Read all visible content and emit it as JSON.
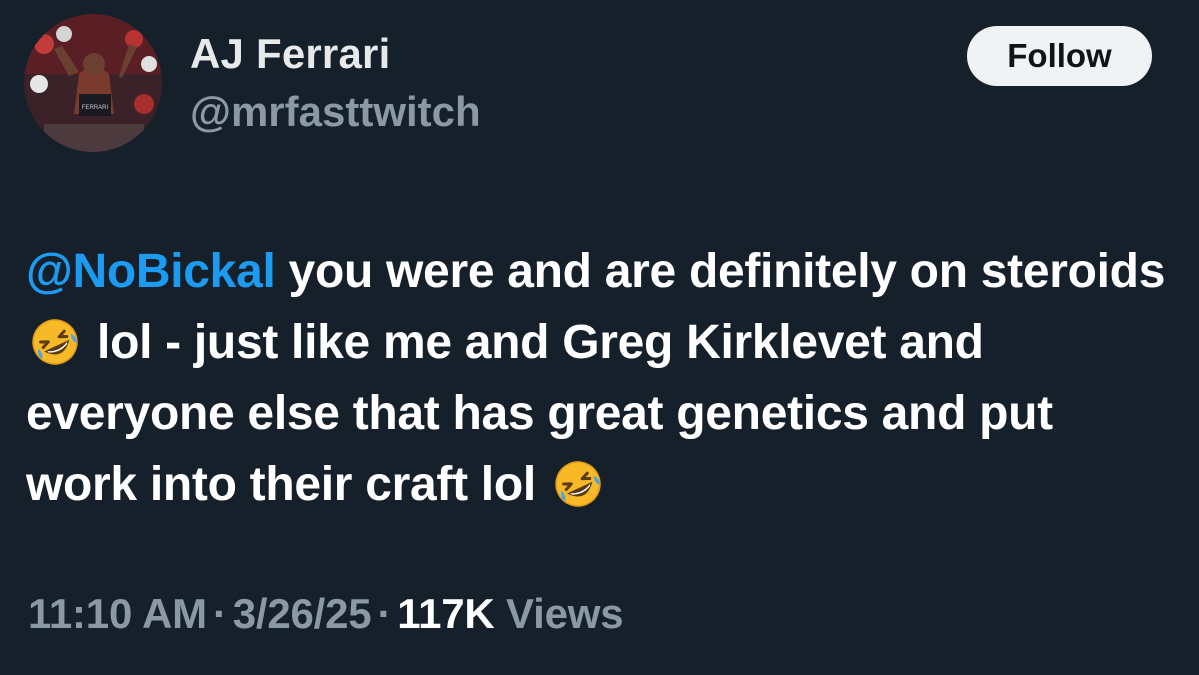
{
  "user": {
    "display_name": "AJ Ferrari",
    "handle": "@mrfasttwitch"
  },
  "actions": {
    "follow_label": "Follow"
  },
  "tweet": {
    "mention": "@NoBickal",
    "text_part1": " you were and are definitely on steroids ",
    "text_part2": " lol - just like me and Greg Kirklevet and everyone else that has great genetics and put work into their craft lol ",
    "emoji_1": "rolling-on-floor-laughing-emoji",
    "emoji_2": "rolling-on-floor-laughing-emoji"
  },
  "meta": {
    "time": "11:10 AM",
    "separator": "·",
    "date": "3/26/25",
    "views_count": "117K",
    "views_label": "Views"
  },
  "colors": {
    "background": "#15202b",
    "mention": "#1d9bf0",
    "secondary_text": "#8b98a5",
    "follow_bg": "#eff3f4"
  }
}
